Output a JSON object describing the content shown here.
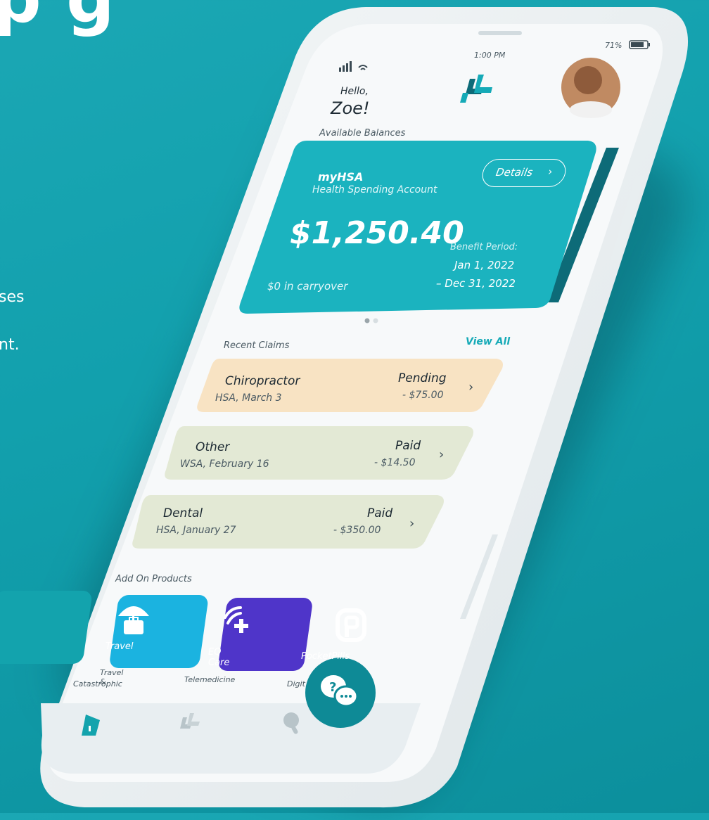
{
  "background": {
    "title_fragment": "p g",
    "line_fragment_1": "ses",
    "line_fragment_2": "nt."
  },
  "status_bar": {
    "time": "1:00 PM",
    "battery": "71%"
  },
  "header": {
    "greeting": "Hello,",
    "name": "Zoe!",
    "logo_icon": "plus-logo-icon"
  },
  "balances": {
    "section_label": "Available Balances",
    "card": {
      "account_name": "myHSA",
      "account_type": "Health Spending Account",
      "details_label": "Details",
      "amount": "$1,250.40",
      "carryover": "$0 in carryover",
      "benefit_period_label": "Benefit Period:",
      "period_start": "Jan 1, 2022",
      "period_end": "– Dec 31, 2022"
    }
  },
  "claims": {
    "section_label": "Recent Claims",
    "view_all": "View All",
    "items": [
      {
        "title": "Chiropractor",
        "sub": "HSA, March 3",
        "status": "Pending",
        "amount": "- $75.00",
        "color": "#f8e3c3"
      },
      {
        "title": "Other",
        "sub": "WSA, February 16",
        "status": "Paid",
        "amount": "- $14.50",
        "color": "#e3e9d5"
      },
      {
        "title": "Dental",
        "sub": "HSA, January 27",
        "status": "Paid",
        "amount": "- $350.00",
        "color": "#e3e9d5"
      }
    ]
  },
  "products": {
    "section_label": "Add On Products",
    "items": [
      {
        "tile_label": "Travel",
        "caption_1": "Travel &",
        "caption_2": "Catastrophic",
        "color": "#13a3ad",
        "icon": "umbrella-suitcase-icon"
      },
      {
        "tile_label": "EQ Care",
        "caption_1": "Telemedicine",
        "caption_2": "",
        "color": "#1bb3e0",
        "icon": "signal-plus-icon"
      },
      {
        "tile_label": "PocketPills",
        "caption_1": "Digit",
        "caption_2": "",
        "color": "#4f35c9",
        "icon": "pocketpills-p-icon"
      }
    ]
  },
  "chat": {
    "icon": "chat-bubbles-icon"
  },
  "tab_bar": {
    "items": [
      "home-icon",
      "plus-logo-icon",
      "search-icon"
    ]
  },
  "colors": {
    "accent": "#15aab7",
    "card": "#1bb3bf",
    "dark_teal": "#0d6b78"
  }
}
